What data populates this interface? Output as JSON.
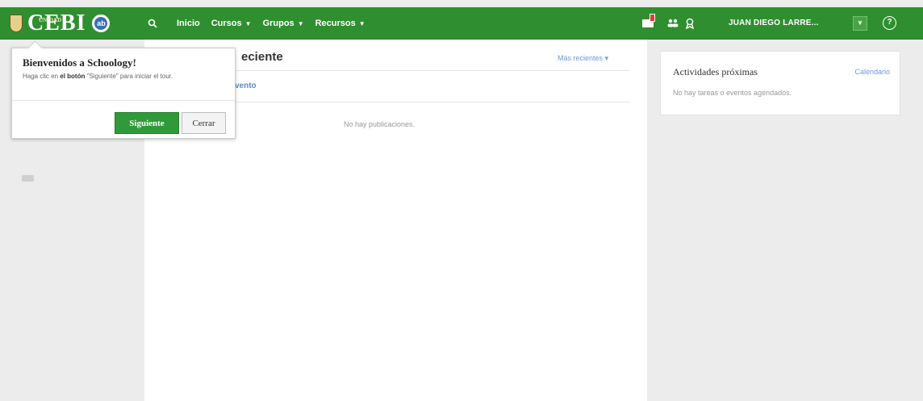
{
  "header": {
    "logo_text": "CEBI",
    "logo_small": "UNIDAD EDUCATIVA",
    "badge_text": "ab",
    "nav": [
      {
        "label": "Inicio"
      },
      {
        "label": "Cursos",
        "dropdown": true
      },
      {
        "label": "Grupos",
        "dropdown": true
      },
      {
        "label": "Recursos",
        "dropdown": true
      }
    ],
    "user_name": "JUAN DIEGO LARRE...",
    "icons": [
      "search-icon",
      "messages-icon",
      "connections-icon",
      "badges-icon",
      "help-icon"
    ],
    "brand_color": "#2f8f30",
    "notification_color": "#e53935"
  },
  "main": {
    "title_partial": "eciente",
    "more_recent": "Más recientes ▾",
    "event_link_partial": "vento",
    "empty_text": "No hay publicaciones."
  },
  "upcoming": {
    "title": "Actividades próximas",
    "calendar_link": "Calendario",
    "empty_text": "No hay tareas o eventos agendados."
  },
  "tour_popover": {
    "title": "Bienvenidos a Schoology!",
    "text_before": "Haga clic en ",
    "text_bold": "el botón",
    "text_after": " \"Siguiente\" para iniciar el tour.",
    "next_label": "Siguiente",
    "close_label": "Cerrar"
  }
}
